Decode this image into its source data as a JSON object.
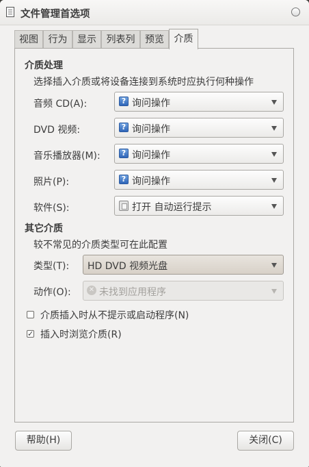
{
  "window": {
    "title": "文件管理首选项"
  },
  "tabs": [
    {
      "label": "视图"
    },
    {
      "label": "行为"
    },
    {
      "label": "显示"
    },
    {
      "label": "列表列"
    },
    {
      "label": "预览"
    },
    {
      "label": "介质"
    }
  ],
  "media": {
    "heading": "介质处理",
    "description": "选择插入介质或将设备连接到系统时应执行何种操作",
    "rows": [
      {
        "label": "音频 CD(A):",
        "value": "询问操作",
        "icon": "question-icon"
      },
      {
        "label": "DVD 视频:",
        "value": "询问操作",
        "icon": "question-icon"
      },
      {
        "label": "音乐播放器(M):",
        "value": "询问操作",
        "icon": "question-icon"
      },
      {
        "label": "照片(P):",
        "value": "询问操作",
        "icon": "question-icon"
      },
      {
        "label": "软件(S):",
        "value": "打开 自动运行提示",
        "icon": "application-icon"
      }
    ]
  },
  "other": {
    "heading": "其它介质",
    "description": "较不常见的介质类型可在此配置",
    "type_label": "类型(T):",
    "type_value": "HD DVD 视频光盘",
    "action_label": "动作(O):",
    "action_value": "未找到应用程序"
  },
  "options": [
    {
      "label": "介质插入时从不提示或启动程序(N)",
      "checked": false
    },
    {
      "label": "插入时浏览介质(R)",
      "checked": true
    }
  ],
  "buttons": {
    "help": "帮助(H)",
    "close": "关闭(C)"
  }
}
